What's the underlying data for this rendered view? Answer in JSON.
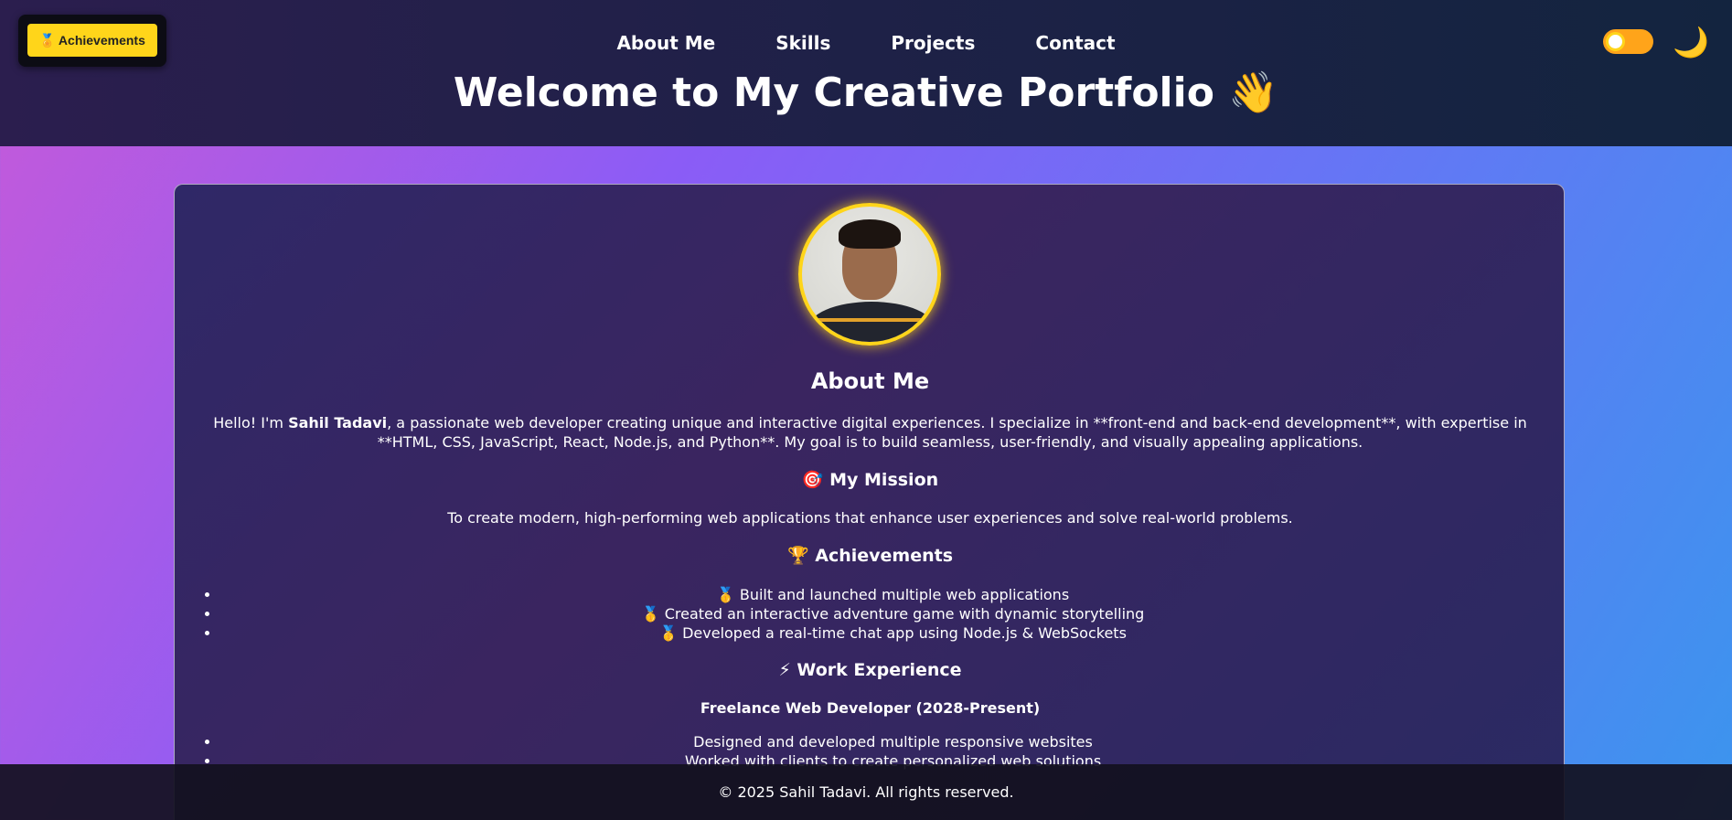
{
  "header": {
    "achievements_button": "🏅 Achievements",
    "nav": [
      "About Me",
      "Skills",
      "Projects",
      "Contact"
    ],
    "moon_icon": "🌙",
    "title": "Welcome to My Creative Portfolio 👋"
  },
  "about": {
    "heading": "About Me",
    "greeting": "Hello! I'm ",
    "name": "Sahil Tadavi",
    "text": ", a passionate web developer creating unique and interactive digital experiences. I specialize in **front-end and back-end development**, with expertise in **HTML, CSS, JavaScript, React, Node.js, and Python**. My goal is to build seamless, user-friendly, and visually appealing applications."
  },
  "mission": {
    "heading": "🎯 My Mission",
    "text": "To create modern, high-performing web applications that enhance user experiences and solve real-world problems."
  },
  "achievements": {
    "heading": "🏆 Achievements",
    "items": [
      "🥇 Built and launched multiple web applications",
      "🥇 Created an interactive adventure game with dynamic storytelling",
      "🥇 Developed a real-time chat app using Node.js & WebSockets"
    ]
  },
  "work": {
    "heading": "⚡ Work Experience",
    "job_title": "Freelance Web Developer (2028-Present)",
    "items": [
      "Designed and developed multiple responsive websites",
      "Worked with clients to create personalized web solutions"
    ]
  },
  "footer": {
    "text": "© 2025 Sahil Tadavi. All rights reserved."
  },
  "colors": {
    "accent": "#ffd51a",
    "toggle": "#ffa41a"
  }
}
